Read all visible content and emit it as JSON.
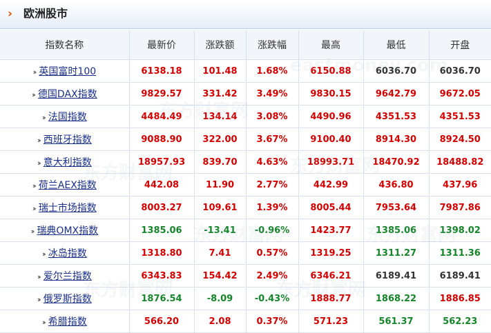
{
  "header": {
    "arrow_glyph": "›",
    "title": "欧洲股市"
  },
  "table": {
    "columns": [
      "指数名称",
      "最新价",
      "涨跌额",
      "涨跌幅",
      "最高",
      "最低",
      "开盘"
    ],
    "rows": [
      {
        "name": "英国富时100",
        "latest": "6138.18",
        "change": "101.48",
        "pct": "1.68%",
        "high": "6150.88",
        "low": "6036.70",
        "open": "6036.70",
        "cls": [
          "up",
          "up",
          "up",
          "up",
          "flat",
          "flat"
        ]
      },
      {
        "name": "德国DAX指数",
        "latest": "9829.57",
        "change": "331.42",
        "pct": "3.49%",
        "high": "9830.15",
        "low": "9642.79",
        "open": "9672.05",
        "cls": [
          "up",
          "up",
          "up",
          "up",
          "up",
          "up"
        ]
      },
      {
        "name": "法国指数",
        "latest": "4484.49",
        "change": "134.14",
        "pct": "3.08%",
        "high": "4490.96",
        "low": "4351.53",
        "open": "4351.53",
        "cls": [
          "up",
          "up",
          "up",
          "up",
          "up",
          "up"
        ]
      },
      {
        "name": "西班牙指数",
        "latest": "9088.90",
        "change": "322.00",
        "pct": "3.67%",
        "high": "9100.40",
        "low": "8914.30",
        "open": "8924.50",
        "cls": [
          "up",
          "up",
          "up",
          "up",
          "up",
          "up"
        ]
      },
      {
        "name": "意大利指数",
        "latest": "18957.93",
        "change": "839.70",
        "pct": "4.63%",
        "high": "18993.71",
        "low": "18470.92",
        "open": "18488.82",
        "cls": [
          "up",
          "up",
          "up",
          "up",
          "up",
          "up"
        ]
      },
      {
        "name": "荷兰AEX指数",
        "latest": "442.08",
        "change": "11.90",
        "pct": "2.77%",
        "high": "442.99",
        "low": "436.80",
        "open": "437.96",
        "cls": [
          "up",
          "up",
          "up",
          "up",
          "up",
          "up"
        ]
      },
      {
        "name": "瑞士市场指数",
        "latest": "8003.27",
        "change": "109.61",
        "pct": "1.39%",
        "high": "8005.44",
        "low": "7953.64",
        "open": "7987.86",
        "cls": [
          "up",
          "up",
          "up",
          "up",
          "up",
          "up"
        ]
      },
      {
        "name": "瑞典OMX指数",
        "latest": "1385.06",
        "change": "-13.41",
        "pct": "-0.96%",
        "high": "1423.77",
        "low": "1385.06",
        "open": "1398.02",
        "cls": [
          "down",
          "down",
          "down",
          "up",
          "down",
          "down"
        ]
      },
      {
        "name": "冰岛指数",
        "latest": "1318.80",
        "change": "7.41",
        "pct": "0.57%",
        "high": "1319.25",
        "low": "1311.27",
        "open": "1311.36",
        "cls": [
          "up",
          "up",
          "up",
          "up",
          "down",
          "down"
        ]
      },
      {
        "name": "爱尔兰指数",
        "latest": "6343.83",
        "change": "154.42",
        "pct": "2.49%",
        "high": "6346.21",
        "low": "6189.41",
        "open": "6189.41",
        "cls": [
          "up",
          "up",
          "up",
          "up",
          "flat",
          "flat"
        ]
      },
      {
        "name": "俄罗斯指数",
        "latest": "1876.54",
        "change": "-8.09",
        "pct": "-0.43%",
        "high": "1888.77",
        "low": "1868.22",
        "open": "1886.85",
        "cls": [
          "down",
          "down",
          "down",
          "up",
          "down",
          "up"
        ]
      },
      {
        "name": "希腊指数",
        "latest": "566.20",
        "change": "2.08",
        "pct": "0.37%",
        "high": "571.23",
        "low": "561.37",
        "open": "562.23",
        "cls": [
          "up",
          "up",
          "up",
          "up",
          "down",
          "down"
        ]
      }
    ]
  },
  "colors": {
    "up": "#d40000",
    "down": "#15852a",
    "flat": "#333333",
    "link": "#1a2f88",
    "accent_arrow": "#e05a00"
  },
  "icons": {
    "row_marker": "double-chevron-right-icon",
    "title_marker": "chevron-right-icon"
  }
}
